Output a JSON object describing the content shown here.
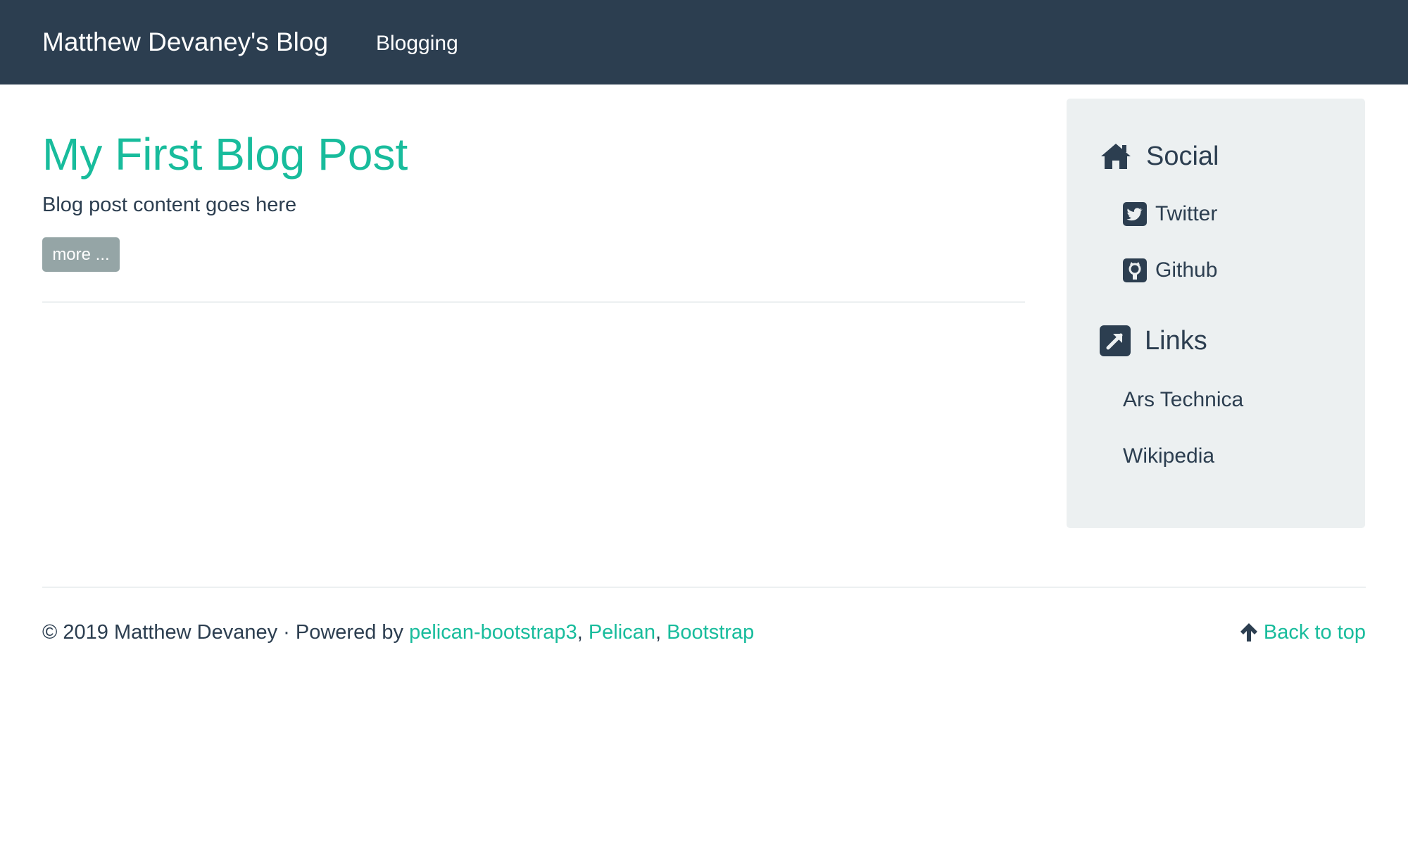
{
  "navbar": {
    "brand": "Matthew Devaney's Blog",
    "links": [
      {
        "label": "Blogging"
      }
    ]
  },
  "post": {
    "title": "My First Blog Post",
    "summary": "Blog post content goes here",
    "more_label": "more ..."
  },
  "sidebar": {
    "social": {
      "heading": "Social",
      "icon": "home-icon",
      "items": [
        {
          "label": "Twitter",
          "icon": "twitter-square-icon"
        },
        {
          "label": "Github",
          "icon": "github-square-icon"
        }
      ]
    },
    "links": {
      "heading": "Links",
      "icon": "external-link-square-icon",
      "items": [
        {
          "label": "Ars Technica"
        },
        {
          "label": "Wikipedia"
        }
      ]
    }
  },
  "footer": {
    "copyright": "© 2019 Matthew Devaney · Powered by ",
    "powered_links": [
      {
        "label": "pelican-bootstrap3"
      },
      {
        "label": "Pelican"
      },
      {
        "label": "Bootstrap"
      }
    ],
    "separator": ", ",
    "back_to_top": "Back to top",
    "back_to_top_icon": "arrow-up-icon"
  },
  "colors": {
    "navbar_bg": "#2c3e50",
    "accent": "#18bc9c",
    "text": "#2c3e50",
    "sidebar_bg": "#ecf0f1",
    "button_bg": "#95a5a6"
  }
}
